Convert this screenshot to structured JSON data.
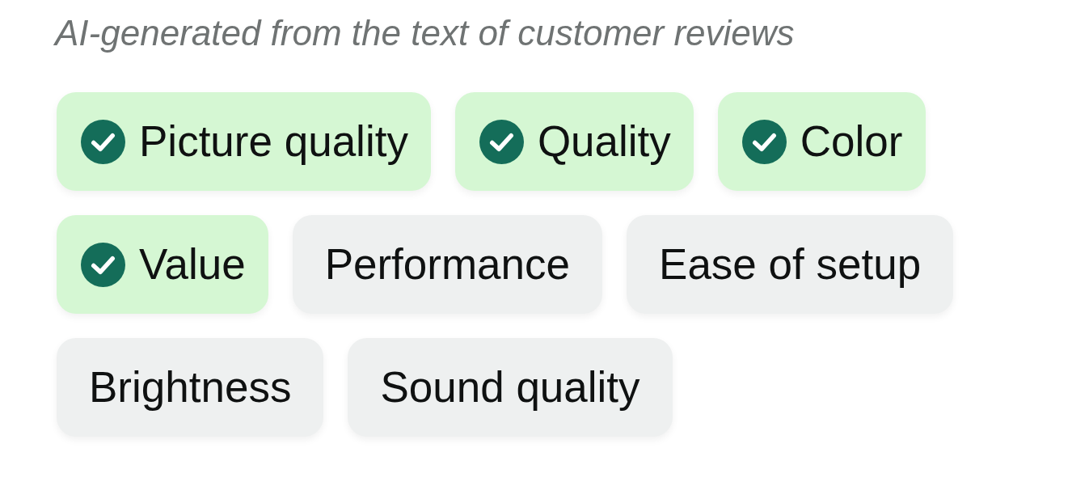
{
  "subtitle": "AI-generated from the text of customer reviews",
  "chips": [
    {
      "label": "Picture quality",
      "selected": true
    },
    {
      "label": "Quality",
      "selected": true
    },
    {
      "label": "Color",
      "selected": true
    },
    {
      "label": "Value",
      "selected": true
    },
    {
      "label": "Performance",
      "selected": false
    },
    {
      "label": "Ease of setup",
      "selected": false
    },
    {
      "label": "Brightness",
      "selected": false
    },
    {
      "label": "Sound quality",
      "selected": false
    }
  ]
}
